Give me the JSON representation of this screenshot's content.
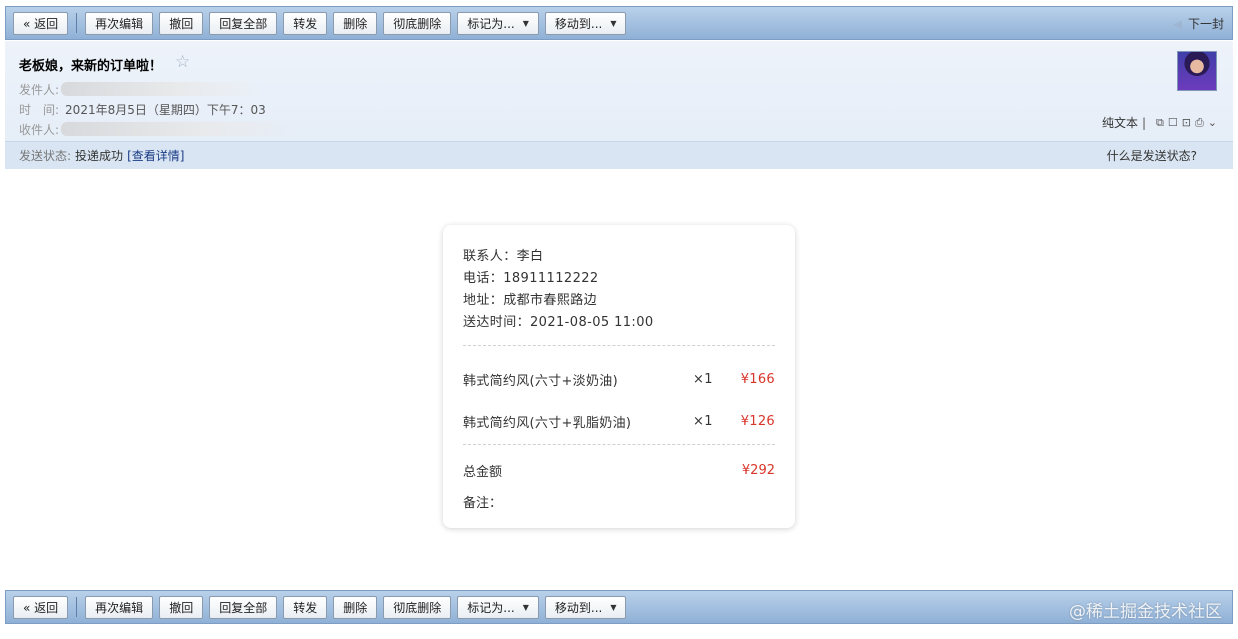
{
  "toolbar": {
    "back": "« 返回",
    "edit_again": "再次编辑",
    "recall": "撤回",
    "reply_all": "回复全部",
    "forward": "转发",
    "delete": "删除",
    "delete_forever": "彻底删除",
    "mark_as": "标记为...",
    "move_to": "移动到...",
    "next": "下一封"
  },
  "watermark": "@稀土掘金技术社区",
  "mail": {
    "subject": "老板娘，来新的订单啦！",
    "from_label": "发件人:",
    "time_label": "时　间:",
    "time_value": "2021年8月5日（星期四）下午7：03",
    "to_label": "收件人:",
    "plain_text": "纯文本",
    "status_label": "发送状态:",
    "status_value": "投递成功",
    "status_link": "[查看详情]",
    "status_help": "什么是发送状态?"
  },
  "order": {
    "contact": "联系人：李白",
    "phone": "电话：18911112222",
    "address": "地址：成都市春熙路边",
    "delivery_time": "送达时间：2021-08-05 11:00",
    "items": [
      {
        "name": "韩式简约风(六寸+淡奶油)",
        "qty": "×1",
        "price": "¥166"
      },
      {
        "name": "韩式简约风(六寸+乳脂奶油)",
        "qty": "×1",
        "price": "¥126"
      }
    ],
    "total_label": "总金额",
    "total_value": "¥292",
    "remark": "备注："
  }
}
